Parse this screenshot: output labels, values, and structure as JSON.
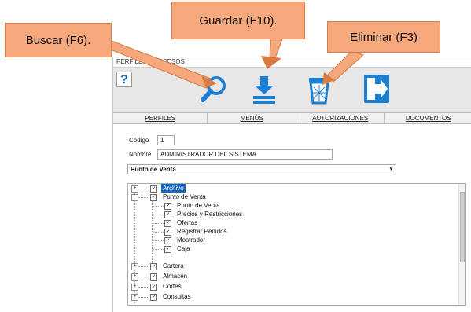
{
  "window": {
    "title": "PERFILES Y ACCESOS"
  },
  "toolbar": {
    "help_label": "?",
    "buttons": [
      {
        "name": "search",
        "icon": "search-icon",
        "color": "#1e7fd0"
      },
      {
        "name": "save",
        "icon": "download-icon",
        "color": "#1e7fd0"
      },
      {
        "name": "delete",
        "icon": "trash-icon",
        "color": "#1e7fd0"
      },
      {
        "name": "exit",
        "icon": "exit-icon",
        "color": "#1e7fd0"
      }
    ]
  },
  "tabs": [
    "PERFILES",
    "MENÚS",
    "AUTORIZACIONES",
    "DOCUMENTOS"
  ],
  "form": {
    "codigo_label": "Código",
    "codigo_value": "1",
    "nombre_label": "Nombre",
    "nombre_value": "ADMINISTRADOR DEL SISTEMA",
    "module_selected": "Punto de Venta"
  },
  "tree": [
    {
      "label": "Archivo",
      "checked": true,
      "expander": "+",
      "level": 0,
      "selected": true
    },
    {
      "label": "Punto de Venta",
      "checked": true,
      "expander": "-",
      "level": 0
    },
    {
      "label": "Punto de Venta",
      "checked": true,
      "level": 1
    },
    {
      "label": "Precios y Restricciones",
      "checked": true,
      "level": 1
    },
    {
      "label": "Ofertas",
      "checked": true,
      "level": 1
    },
    {
      "label": "Registrar Pedidos",
      "checked": true,
      "level": 1
    },
    {
      "label": "Mostrador",
      "checked": true,
      "level": 1
    },
    {
      "label": "Caja",
      "checked": true,
      "level": 1
    },
    {
      "label": "Cartera",
      "checked": true,
      "expander": "+",
      "level": 0
    },
    {
      "label": "Almacén",
      "checked": true,
      "expander": "+",
      "level": 0
    },
    {
      "label": "Cortes",
      "checked": true,
      "expander": "+",
      "level": 0
    },
    {
      "label": "Consultas",
      "checked": true,
      "expander": "+",
      "level": 0
    }
  ],
  "callouts": {
    "buscar": "Buscar (F6).",
    "guardar": "Guardar (F10).",
    "eliminar": "Eliminar (F3)"
  },
  "colors": {
    "callout_fill": "#f4a87c",
    "icon_blue": "#1e7fd0",
    "selection": "#1565c0"
  }
}
